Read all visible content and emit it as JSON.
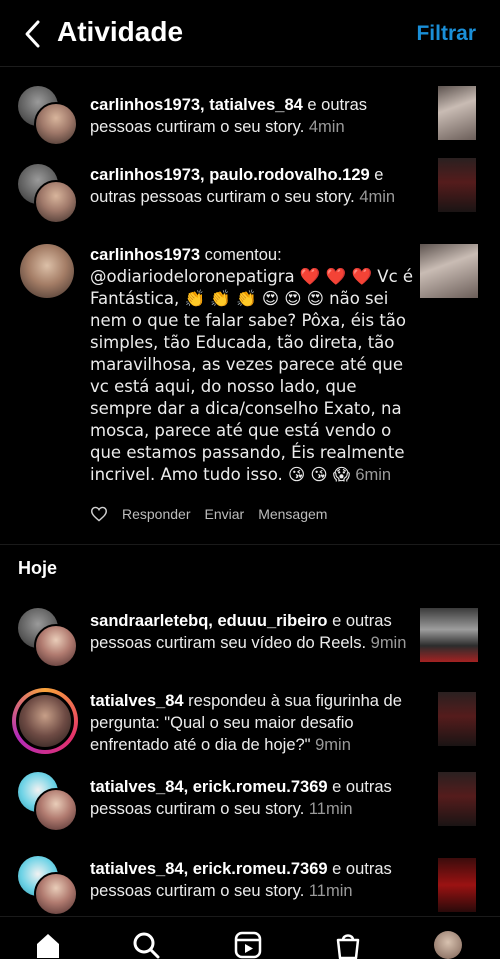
{
  "header": {
    "title": "Atividade",
    "filter_label": "Filtrar"
  },
  "notifications": [
    {
      "users": "carlinhos1973, tatialves_84",
      "rest": " e outras pessoas curtiram o seu story. ",
      "time": "4min"
    },
    {
      "users": "carlinhos1973, paulo.rodovalho.129",
      "rest": " e outras pessoas curtiram o seu story. ",
      "time": "4min"
    },
    {
      "user": "carlinhos1973",
      "action": " comentou: ",
      "comment": "@odiariodeloronepatigra ❤️ ❤️ ❤️ Vc é Fantástica, 👏 👏 👏 😍 😍 😍 não sei nem o que te falar sabe? Pôxa, éis tão simples, tão Educada, tão direta, tão maravilhosa, as vezes parece até que vc está aqui, do nosso lado, que sempre dar a dica/conselho Exato, na mosca, parece até que está vendo o que estamos passando, Éis realmente incrivel. Amo tudo isso. 😘 😘 😱 ",
      "time": "6min",
      "reply_label": "Responder",
      "send_label": "Enviar",
      "message_label": "Mensagem"
    }
  ],
  "section_today": "Hoje",
  "today": [
    {
      "users": "sandraarletebq, eduuu_ribeiro",
      "rest": " e outras pessoas curtiram seu vídeo do Reels. ",
      "time": "9min"
    },
    {
      "user": "tatialves_84",
      "rest": " respondeu à sua figurinha de pergunta: \"Qual o seu maior desafio enfrentado até o dia de hoje?\" ",
      "time": "9min"
    },
    {
      "users": "tatialves_84, erick.romeu.7369",
      "rest": " e outras pessoas curtiram o seu story. ",
      "time": "11min"
    },
    {
      "users": "tatialves_84, erick.romeu.7369",
      "rest": " e outras pessoas curtiram o seu story. ",
      "time": "11min"
    }
  ],
  "tabbar": {
    "icons": [
      "home-icon",
      "search-icon",
      "reels-icon",
      "shop-icon",
      "profile-avatar"
    ]
  },
  "colors": {
    "accent": "#1a8fd8",
    "background": "#000000"
  }
}
